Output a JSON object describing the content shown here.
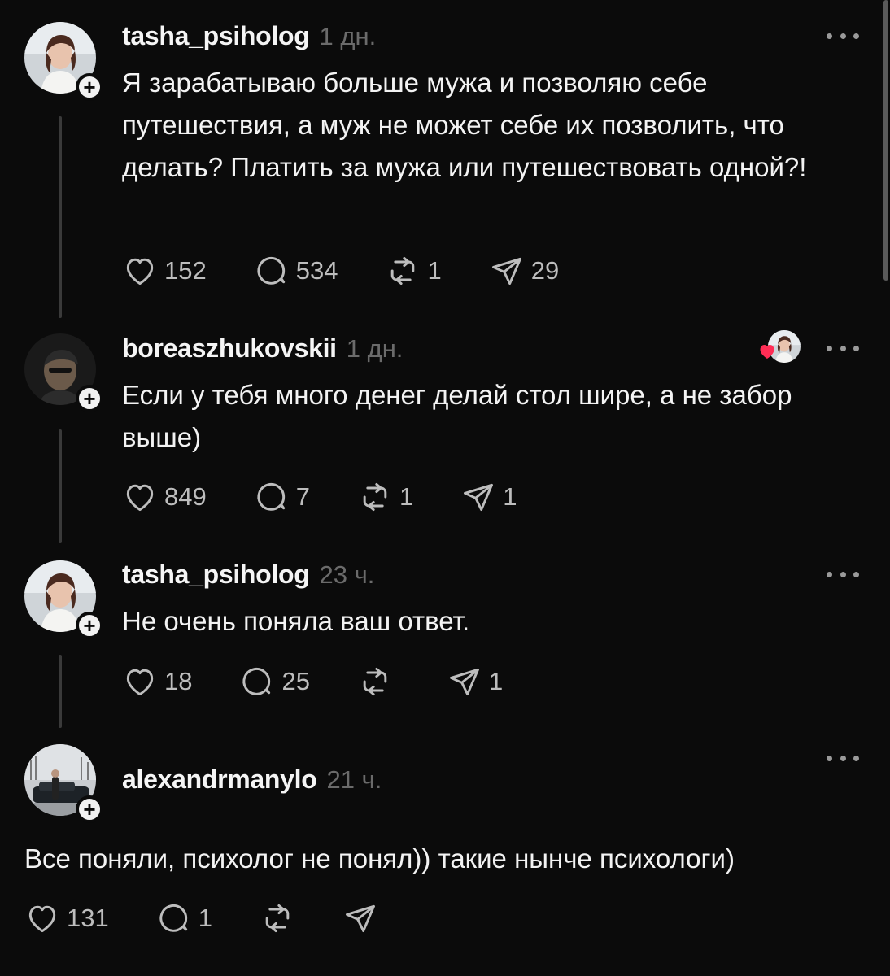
{
  "posts": [
    {
      "username": "tasha_psiholog",
      "time": "1 дн.",
      "text": "Я зарабатываю больше мужа и позволяю себе путешествия, а муж не может себе их позволить, что делать? Платить за мужа или путешествовать одной?!",
      "likes": "152",
      "comments": "534",
      "reposts": "1",
      "shares": "29"
    },
    {
      "username": "boreaszhukovskii",
      "time": "1 дн.",
      "text": "Если у тебя много денег делай стол шире, а не забор выше)",
      "likes": "849",
      "comments": "7",
      "reposts": "1",
      "shares": "1"
    },
    {
      "username": "tasha_psiholog",
      "time": "23 ч.",
      "text": "Не очень поняла ваш ответ.",
      "likes": "18",
      "comments": "25",
      "reposts": "",
      "shares": "1"
    },
    {
      "username": "alexandrmanylo",
      "time": "21 ч.",
      "text": "Все поняли, психолог не понял)) такие нынче психологи)",
      "likes": "131",
      "comments": "1",
      "reposts": "",
      "shares": ""
    }
  ],
  "icons": {
    "like": "heart-icon",
    "comment": "comment-icon",
    "repost": "repost-icon",
    "share": "share-icon",
    "more": "more-options-icon",
    "follow": "plus-icon"
  },
  "colors": {
    "background": "#0b0b0b",
    "text": "#f3f3f3",
    "muted": "#6b6b6b",
    "liked_heart": "#ff2d55"
  }
}
